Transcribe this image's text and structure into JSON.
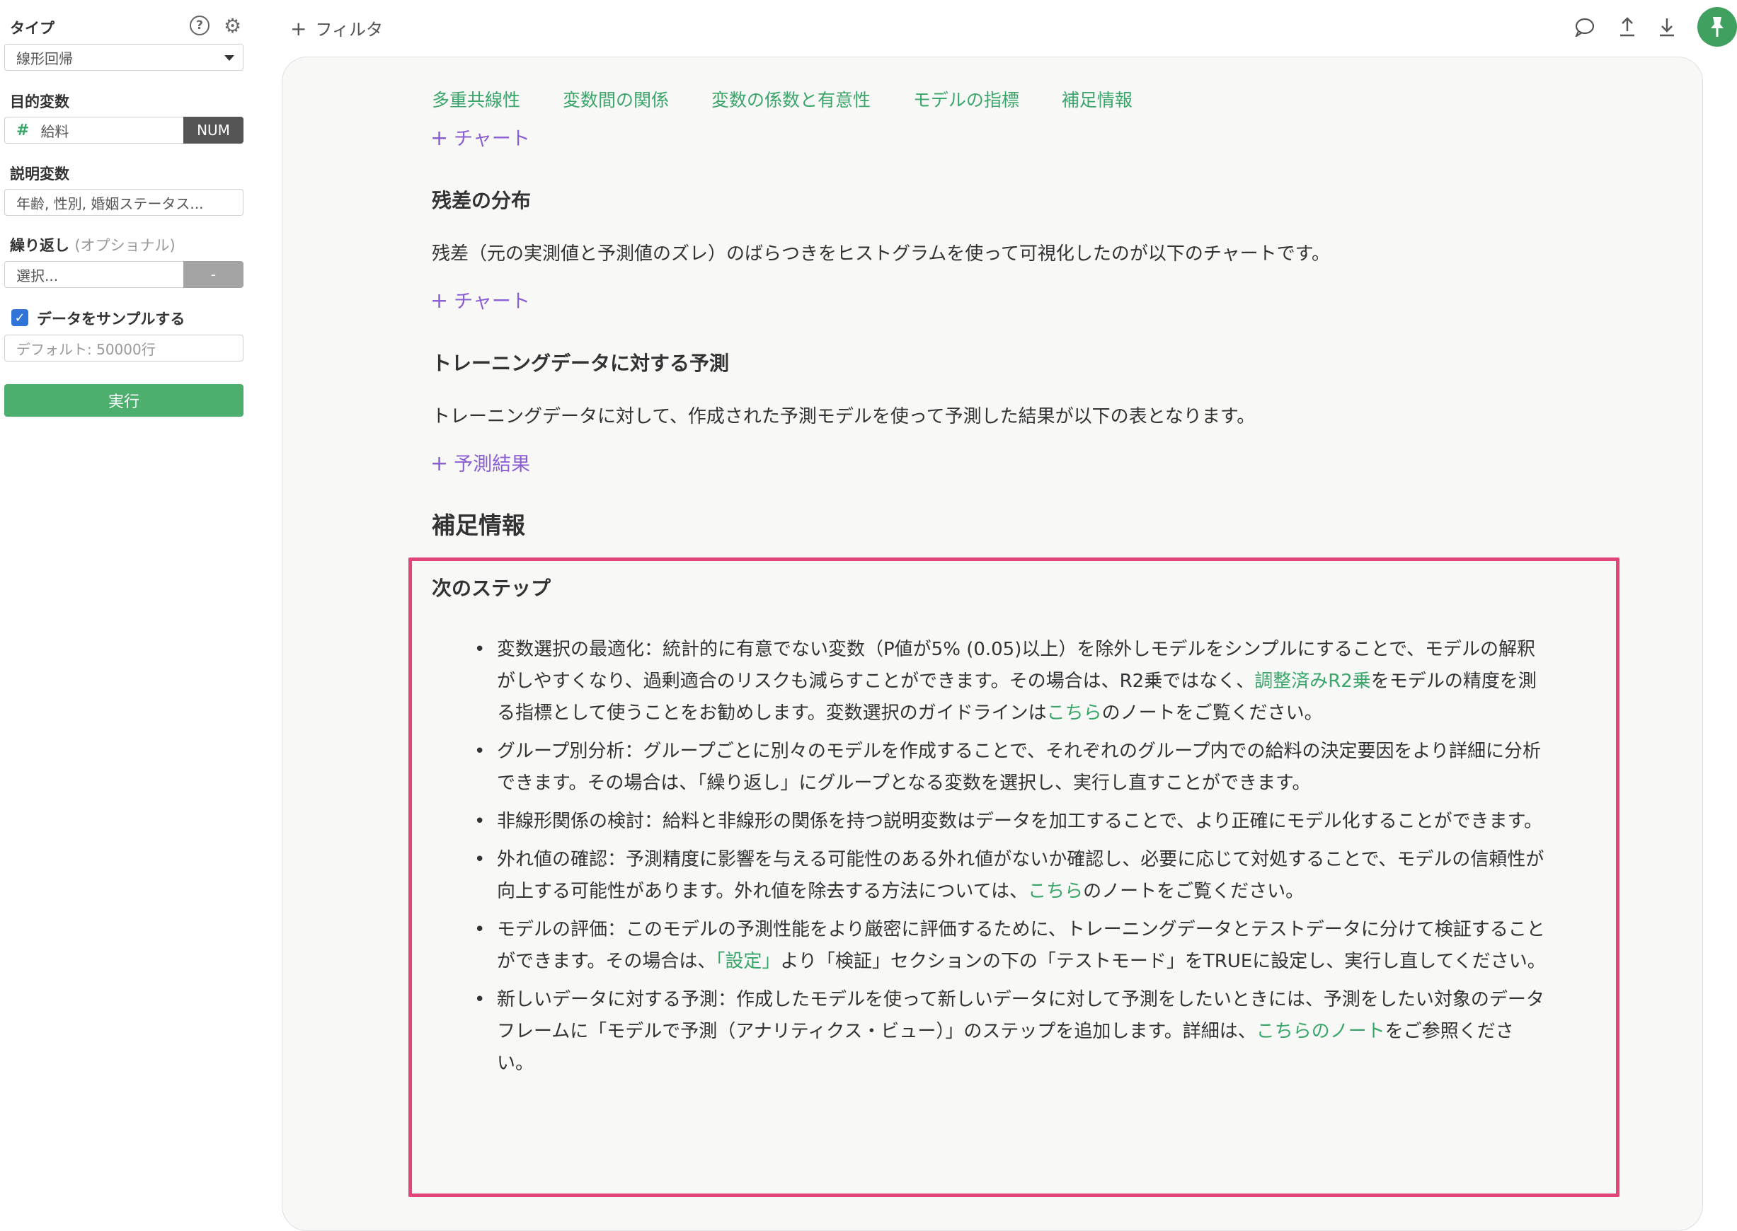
{
  "sidebar": {
    "type_label": "タイプ",
    "type_value": "線形回帰",
    "target_label": "目的変数",
    "target_hash": "#",
    "target_value": "給料",
    "target_badge": "NUM",
    "explanatory_label": "説明変数",
    "explanatory_value": "年齢, 性別, 婚姻ステータス...",
    "repeat_label": "繰り返し",
    "repeat_optional": "(オプショナル)",
    "repeat_value": "選択...",
    "repeat_badge": "-",
    "sample_label": "データをサンプルする",
    "sample_placeholder": "デフォルト: 50000行",
    "run_label": "実行",
    "help_icon": "?",
    "gear_icon": "⚙"
  },
  "topbar": {
    "filter_label": "フィルタ",
    "filter_plus": "+",
    "icons": [
      "comment-icon",
      "upload-icon",
      "download-icon",
      "pin-icon"
    ],
    "accent": "#3fa060"
  },
  "main": {
    "tabs": [
      "多重共線性",
      "変数間の関係",
      "変数の係数と有意性",
      "モデルの指標",
      "補足情報"
    ],
    "chart_link_1": "チャート",
    "residual_heading": "残差の分布",
    "residual_text": "残差（元の実測値と予測値のズレ）のばらつきをヒストグラムを使って可視化したのが以下のチャートです。",
    "chart_link_2": "チャート",
    "training_heading": "トレーニングデータに対する予測",
    "training_text": "トレーニングデータに対して、作成された予測モデルを使って予測した結果が以下の表となります。",
    "prediction_link": "予測結果",
    "supplement_heading": "補足情報",
    "next_steps_heading": "次のステップ",
    "steps": {
      "s1": {
        "a": "変数選択の最適化：統計的に有意でない変数（P値が5% (0.05)以上）を除外しモデルをシンプルにすることで、モデルの解釈がしやすくなり、過剰適合のリスクも減らすことができます。その場合は、R2乗ではなく、",
        "link1": "調整済みR2乗",
        "b": "をモデルの精度を測る指標として使うことをお勧めします。変数選択のガイドラインは",
        "link2": "こちら",
        "c": "のノートをご覧ください。"
      },
      "s2": {
        "a": "グループ別分析：グループごとに別々のモデルを作成することで、それぞれのグループ内での給料の決定要因をより詳細に分析できます。その場合は、「繰り返し」にグループとなる変数を選択し、実行し直すことができます。"
      },
      "s3": {
        "a": "非線形関係の検討：給料と非線形の関係を持つ説明変数はデータを加工することで、より正確にモデル化することができます。"
      },
      "s4": {
        "a": "外れ値の確認：予測精度に影響を与える可能性のある外れ値がないか確認し、必要に応じて対処することで、モデルの信頼性が向上する可能性があります。外れ値を除去する方法については、",
        "link1": "こちら",
        "b": "のノートをご覧ください。"
      },
      "s5": {
        "a": "モデルの評価：このモデルの予測性能をより厳密に評価するために、トレーニングデータとテストデータに分けて検証することができます。その場合は、",
        "link1": "「設定」",
        "b": "より「検証」セクションの下の「テストモード」をTRUEに設定し、実行し直してください。"
      },
      "s6": {
        "a": "新しいデータに対する予測：作成したモデルを使って新しいデータに対して予測をしたいときには、予測をしたい対象のデータフレームに「モデルで予測（アナリティクス・ビュー）」のステップを追加します。詳細は、",
        "link1": "こちらのノート",
        "b": "をご参照ください。"
      }
    },
    "link_color": "#3aa66a",
    "highlight_color": "#e2457a"
  }
}
